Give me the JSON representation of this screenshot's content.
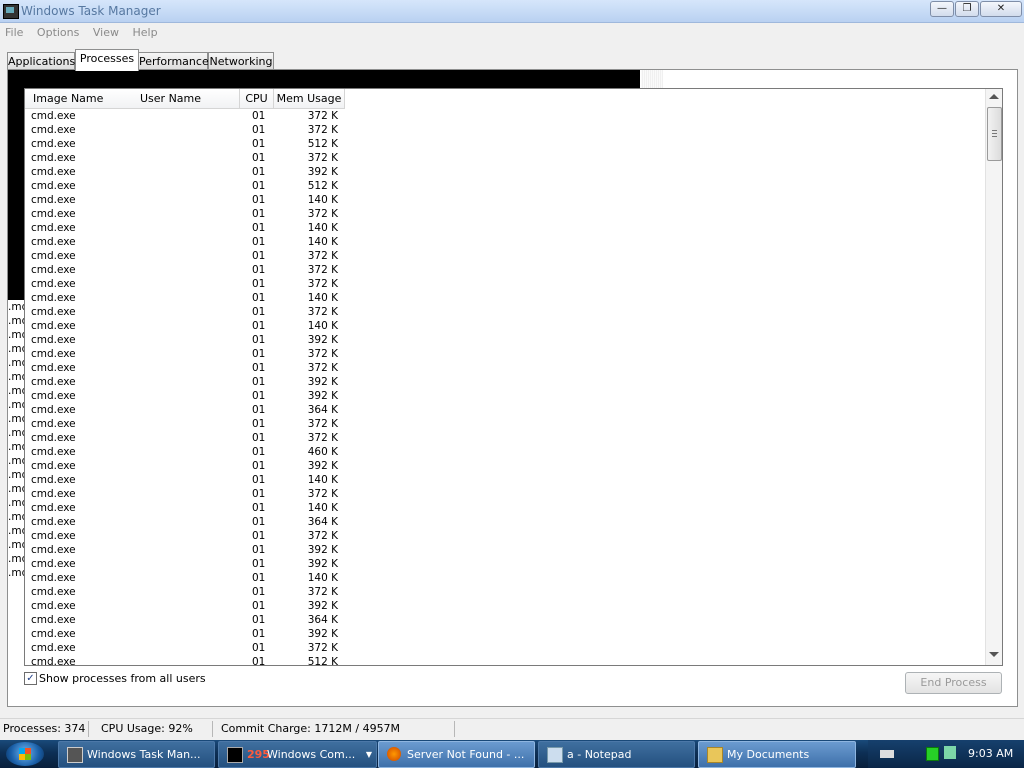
{
  "window": {
    "title": "Windows Task Manager",
    "buttons": {
      "minimize": "—",
      "maximize": "❐",
      "close": "✕"
    }
  },
  "menu": [
    "File",
    "Options",
    "View",
    "Help"
  ],
  "tabs": [
    {
      "label": "Applications",
      "active": false
    },
    {
      "label": "Processes",
      "active": true
    },
    {
      "label": "Performance",
      "active": false
    },
    {
      "label": "Networking",
      "active": false
    }
  ],
  "columns": [
    "Image Name",
    "User Name",
    "CPU",
    "Mem Usage"
  ],
  "processes": [
    {
      "name": "cmd.exe",
      "user": "",
      "cpu": "01",
      "mem": "372 K"
    },
    {
      "name": "cmd.exe",
      "user": "",
      "cpu": "01",
      "mem": "372 K"
    },
    {
      "name": "cmd.exe",
      "user": "",
      "cpu": "01",
      "mem": "512 K"
    },
    {
      "name": "cmd.exe",
      "user": "",
      "cpu": "01",
      "mem": "372 K"
    },
    {
      "name": "cmd.exe",
      "user": "",
      "cpu": "01",
      "mem": "392 K"
    },
    {
      "name": "cmd.exe",
      "user": "",
      "cpu": "01",
      "mem": "512 K"
    },
    {
      "name": "cmd.exe",
      "user": "",
      "cpu": "01",
      "mem": "140 K"
    },
    {
      "name": "cmd.exe",
      "user": "",
      "cpu": "01",
      "mem": "372 K"
    },
    {
      "name": "cmd.exe",
      "user": "",
      "cpu": "01",
      "mem": "140 K"
    },
    {
      "name": "cmd.exe",
      "user": "",
      "cpu": "01",
      "mem": "140 K"
    },
    {
      "name": "cmd.exe",
      "user": "",
      "cpu": "01",
      "mem": "372 K"
    },
    {
      "name": "cmd.exe",
      "user": "",
      "cpu": "01",
      "mem": "372 K"
    },
    {
      "name": "cmd.exe",
      "user": "",
      "cpu": "01",
      "mem": "372 K"
    },
    {
      "name": "cmd.exe",
      "user": "",
      "cpu": "01",
      "mem": "140 K"
    },
    {
      "name": "cmd.exe",
      "user": "",
      "cpu": "01",
      "mem": "372 K"
    },
    {
      "name": "cmd.exe",
      "user": "",
      "cpu": "01",
      "mem": "140 K"
    },
    {
      "name": "cmd.exe",
      "user": "",
      "cpu": "01",
      "mem": "392 K"
    },
    {
      "name": "cmd.exe",
      "user": "",
      "cpu": "01",
      "mem": "372 K"
    },
    {
      "name": "cmd.exe",
      "user": "",
      "cpu": "01",
      "mem": "372 K"
    },
    {
      "name": "cmd.exe",
      "user": "",
      "cpu": "01",
      "mem": "392 K"
    },
    {
      "name": "cmd.exe",
      "user": "",
      "cpu": "01",
      "mem": "392 K"
    },
    {
      "name": "cmd.exe",
      "user": "",
      "cpu": "01",
      "mem": "364 K"
    },
    {
      "name": "cmd.exe",
      "user": "",
      "cpu": "01",
      "mem": "372 K"
    },
    {
      "name": "cmd.exe",
      "user": "",
      "cpu": "01",
      "mem": "372 K"
    },
    {
      "name": "cmd.exe",
      "user": "",
      "cpu": "01",
      "mem": "460 K"
    },
    {
      "name": "cmd.exe",
      "user": "",
      "cpu": "01",
      "mem": "392 K"
    },
    {
      "name": "cmd.exe",
      "user": "",
      "cpu": "01",
      "mem": "140 K"
    },
    {
      "name": "cmd.exe",
      "user": "",
      "cpu": "01",
      "mem": "372 K"
    },
    {
      "name": "cmd.exe",
      "user": "",
      "cpu": "01",
      "mem": "140 K"
    },
    {
      "name": "cmd.exe",
      "user": "",
      "cpu": "01",
      "mem": "364 K"
    },
    {
      "name": "cmd.exe",
      "user": "",
      "cpu": "01",
      "mem": "372 K"
    },
    {
      "name": "cmd.exe",
      "user": "",
      "cpu": "01",
      "mem": "392 K"
    },
    {
      "name": "cmd.exe",
      "user": "",
      "cpu": "01",
      "mem": "392 K"
    },
    {
      "name": "cmd.exe",
      "user": "",
      "cpu": "01",
      "mem": "140 K"
    },
    {
      "name": "cmd.exe",
      "user": "",
      "cpu": "01",
      "mem": "372 K"
    },
    {
      "name": "cmd.exe",
      "user": "",
      "cpu": "01",
      "mem": "392 K"
    },
    {
      "name": "cmd.exe",
      "user": "",
      "cpu": "01",
      "mem": "364 K"
    },
    {
      "name": "cmd.exe",
      "user": "",
      "cpu": "01",
      "mem": "392 K"
    },
    {
      "name": "cmd.exe",
      "user": "",
      "cpu": "01",
      "mem": "372 K"
    },
    {
      "name": "cmd.exe",
      "user": "",
      "cpu": "01",
      "mem": "512 K"
    }
  ],
  "stray_text": [
    ".md",
    ".md",
    ".md",
    ".md",
    ".md",
    ".md",
    ".md",
    ".md",
    ".md",
    ".md",
    ".md",
    ".md",
    ".md",
    ".md",
    ".md",
    ".md",
    ".md",
    ".md",
    ".md",
    ".md"
  ],
  "show_all_users": {
    "label": "Show processes from all users",
    "checked": true,
    "mark": "✓"
  },
  "end_process_label": "End Process",
  "status": {
    "processes": "Processes: 374",
    "cpu": "CPU Usage: 92%",
    "commit": "Commit Charge: 1712M / 4957M"
  },
  "taskbar": {
    "buttons": [
      {
        "label": "Windows Task Man...",
        "icon": "task-manager-icon"
      },
      {
        "badge": "295",
        "label": "Windows Com...",
        "icon": "command-prompt-icon"
      },
      {
        "label": "Server Not Found - ...",
        "icon": "firefox-icon"
      },
      {
        "label": "a - Notepad",
        "icon": "notepad-icon"
      },
      {
        "label": "My Documents",
        "icon": "folder-icon"
      }
    ],
    "clock": "9:03 AM"
  },
  "colors": {
    "taskbar": "#0d2f55",
    "title_text": "#4b6e98",
    "selected_tab": "#ffffff"
  }
}
